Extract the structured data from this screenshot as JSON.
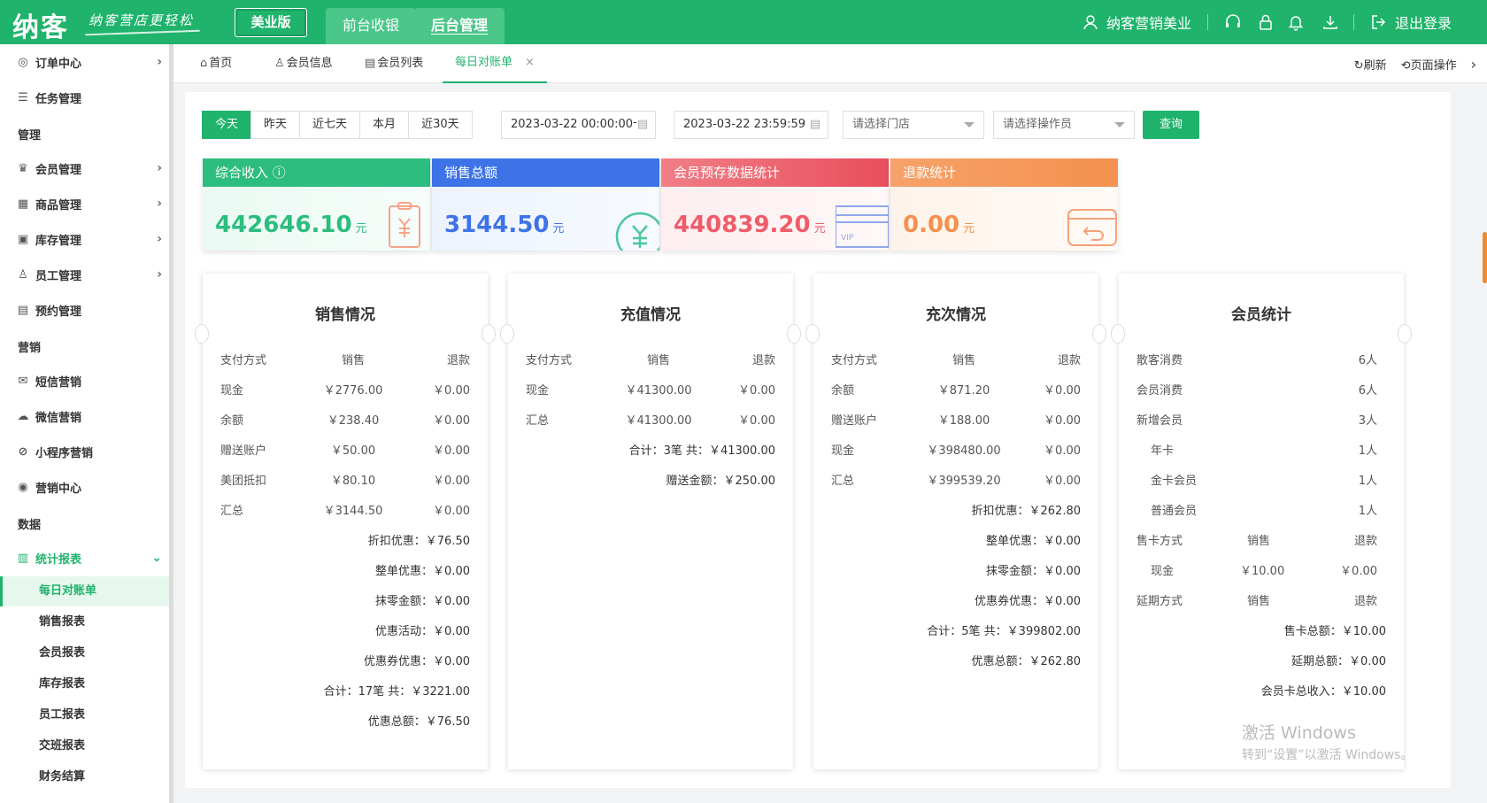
{
  "header": {
    "logo": "纳客",
    "slogan": "纳客营店更轻松",
    "edition": "美业版",
    "tabs": [
      "前台收银",
      "后台管理"
    ],
    "user": "纳客营销美业",
    "logout": "退出登录"
  },
  "sidebar": {
    "items": [
      {
        "label": "订单中心",
        "icon": "globe-icon"
      },
      {
        "label": "任务管理",
        "icon": "list-icon"
      },
      {
        "label": "管理",
        "group": true
      },
      {
        "label": "会员管理",
        "icon": "crown-icon"
      },
      {
        "label": "商品管理",
        "icon": "grid-icon"
      },
      {
        "label": "库存管理",
        "icon": "box-icon"
      },
      {
        "label": "员工管理",
        "icon": "user-icon"
      },
      {
        "label": "预约管理",
        "icon": "calendar-icon"
      },
      {
        "label": "营销",
        "group": true
      },
      {
        "label": "短信营销",
        "icon": "mail-icon"
      },
      {
        "label": "微信营销",
        "icon": "wechat-icon"
      },
      {
        "label": "小程序营销",
        "icon": "miniapp-icon"
      },
      {
        "label": "营销中心",
        "icon": "target-icon"
      },
      {
        "label": "数据",
        "group": true
      },
      {
        "label": "统计报表",
        "icon": "chart-icon"
      }
    ],
    "sub_items": [
      "每日对账单",
      "销售报表",
      "会员报表",
      "库存报表",
      "员工报表",
      "交班报表",
      "财务结算"
    ]
  },
  "page_tabs": [
    {
      "label": "首页",
      "icon": "home-icon"
    },
    {
      "label": "会员信息",
      "icon": "user-icon"
    },
    {
      "label": "会员列表",
      "icon": "doc-icon"
    },
    {
      "label": "每日对账单",
      "icon": ""
    }
  ],
  "tabs_right": {
    "refresh": "刷新",
    "page_ops": "页面操作"
  },
  "filters": {
    "buttons": [
      "今天",
      "昨天",
      "近七天",
      "本月",
      "近30天"
    ],
    "start": "2023-03-22 00:00:00",
    "end": "2023-03-22 23:59:59",
    "dash": "-",
    "store_placeholder": "请选择门店",
    "operator_placeholder": "请选择操作员",
    "query": "查询"
  },
  "stats": [
    {
      "title": "综合收入",
      "value": "442646.10",
      "unit": "元",
      "color": "#2dbd7e"
    },
    {
      "title": "销售总额",
      "value": "3144.50",
      "unit": "元",
      "color": "#3e73e8"
    },
    {
      "title": "会员预存数据统计",
      "value": "440839.20",
      "unit": "元",
      "color": "#ef5c6a"
    },
    {
      "title": "退款统计",
      "value": "0.00",
      "unit": "元",
      "color": "#f4914f"
    }
  ],
  "panels": {
    "sales": {
      "title": "销售情况",
      "header": [
        "支付方式",
        "销售",
        "退款"
      ],
      "rows": [
        [
          "现金",
          "￥2776.00",
          "￥0.00"
        ],
        [
          "余额",
          "￥238.40",
          "￥0.00"
        ],
        [
          "赠送账户",
          "￥50.00",
          "￥0.00"
        ],
        [
          "美团抵扣",
          "￥80.10",
          "￥0.00"
        ],
        [
          "汇总",
          "￥3144.50",
          "￥0.00"
        ]
      ],
      "summary": [
        "折扣优惠：￥76.50",
        "整单优惠：￥0.00",
        "抹零金额：￥0.00",
        "优惠活动：￥0.00",
        "优惠券优惠：￥0.00",
        "合计：17笔 共：￥3221.00",
        "优惠总额：￥76.50"
      ]
    },
    "recharge": {
      "title": "充值情况",
      "header": [
        "支付方式",
        "销售",
        "退款"
      ],
      "rows": [
        [
          "现金",
          "￥41300.00",
          "￥0.00"
        ],
        [
          "汇总",
          "￥41300.00",
          "￥0.00"
        ]
      ],
      "summary": [
        "合计：3笔 共：￥41300.00",
        "赠送金额：￥250.00"
      ]
    },
    "times": {
      "title": "充次情况",
      "header": [
        "支付方式",
        "销售",
        "退款"
      ],
      "rows": [
        [
          "余额",
          "￥871.20",
          "￥0.00"
        ],
        [
          "赠送账户",
          "￥188.00",
          "￥0.00"
        ],
        [
          "现金",
          "￥398480.00",
          "￥0.00"
        ],
        [
          "汇总",
          "￥399539.20",
          "￥0.00"
        ]
      ],
      "summary": [
        "折扣优惠：￥262.80",
        "整单优惠：￥0.00",
        "抹零金额：￥0.00",
        "优惠券优惠：￥0.00",
        "合计：5笔 共：￥399802.00",
        "优惠总额：￥262.80"
      ]
    },
    "members": {
      "title": "会员统计",
      "rows": [
        [
          "散客消费",
          "6人"
        ],
        [
          "会员消费",
          "6人"
        ],
        [
          "新增会员",
          "3人"
        ],
        [
          "年卡",
          "1人"
        ],
        [
          "金卡会员",
          "1人"
        ],
        [
          "普通会员",
          "1人"
        ]
      ],
      "card_header": [
        "售卡方式",
        "销售",
        "退款"
      ],
      "card_row": [
        "现金",
        "￥10.00",
        "￥0.00"
      ],
      "ext_header": [
        "延期方式",
        "销售",
        "退款"
      ],
      "summary": [
        "售卡总额：￥10.00",
        "延期总额：￥0.00",
        "会员卡总收入：￥10.00"
      ]
    }
  },
  "watermark": {
    "line1": "激活 Windows",
    "line2": "转到“设置”以激活 Windows。"
  }
}
